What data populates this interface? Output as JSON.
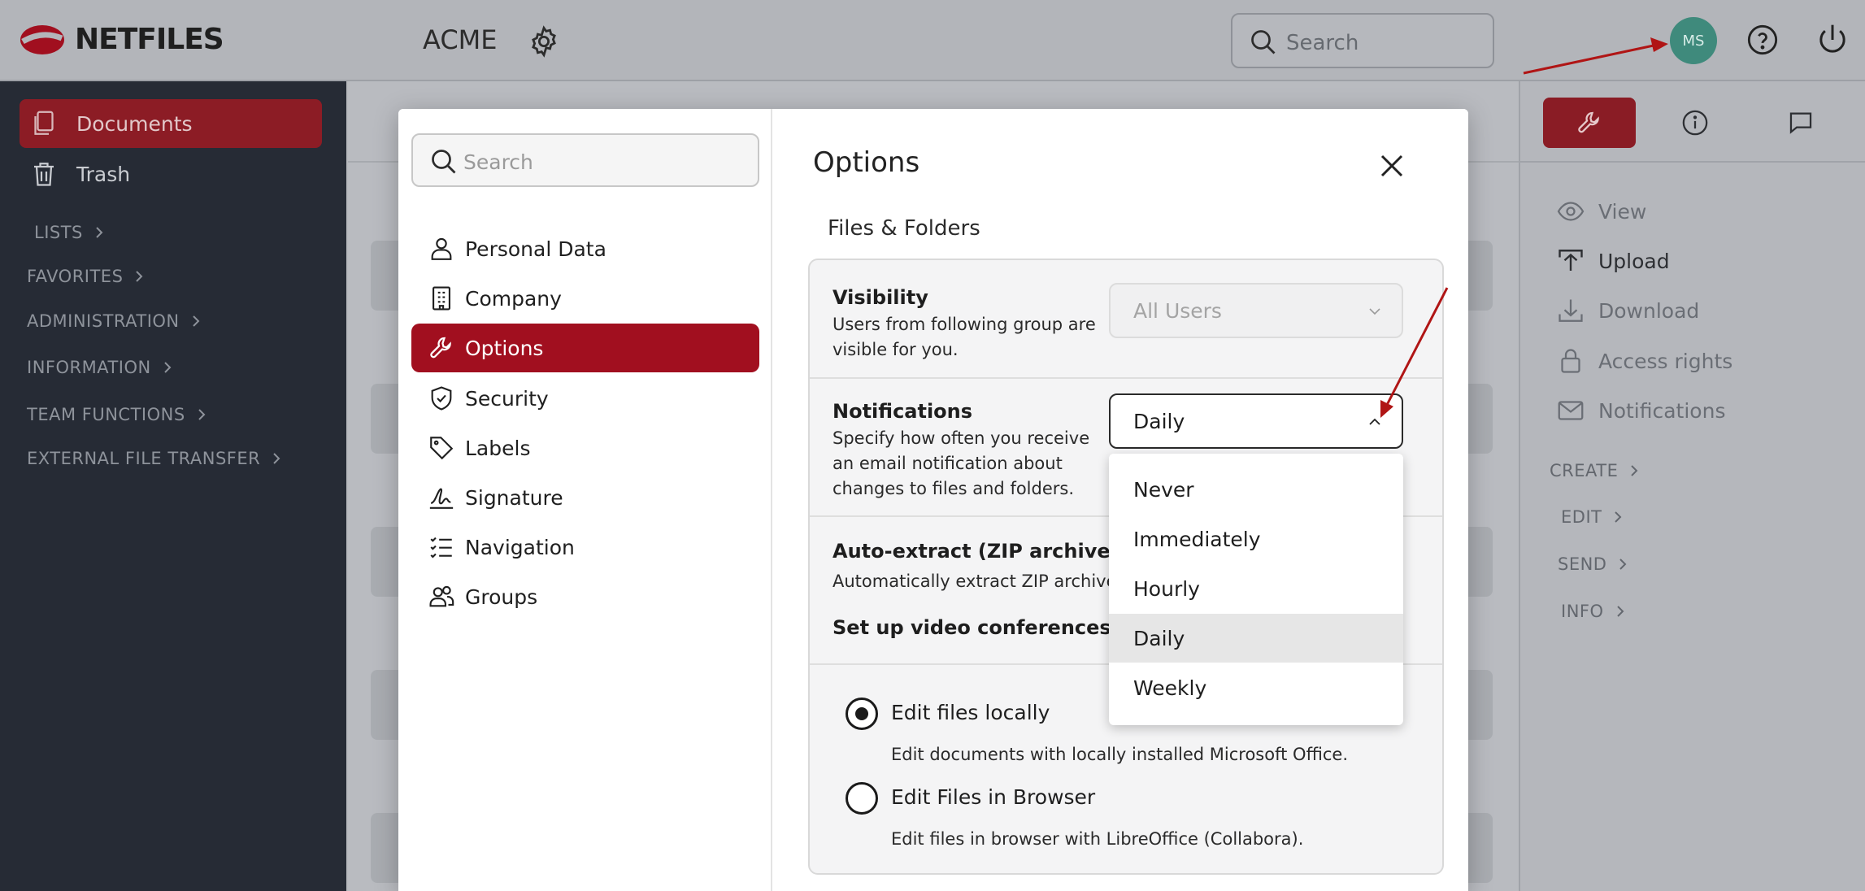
{
  "header": {
    "logo_text": "NETFILES",
    "workspace": "ACME",
    "search_placeholder": "Search",
    "avatar_initials": "MS"
  },
  "sidebar": {
    "items": [
      {
        "label": "Documents",
        "icon": "documents-icon",
        "active": true
      },
      {
        "label": "Trash",
        "icon": "trash-icon",
        "active": false
      }
    ],
    "sections": [
      "LISTS",
      "FAVORITES",
      "ADMINISTRATION",
      "INFORMATION",
      "TEAM FUNCTIONS",
      "EXTERNAL FILE TRANSFER"
    ]
  },
  "right_panel": {
    "tabs": [
      {
        "icon": "wrench-icon",
        "active": true
      },
      {
        "icon": "info-icon",
        "active": false
      },
      {
        "icon": "comment-icon",
        "active": false
      }
    ],
    "actions": [
      {
        "label": "View",
        "icon": "eye-icon"
      },
      {
        "label": "Upload",
        "icon": "upload-icon"
      },
      {
        "label": "Download",
        "icon": "download-icon"
      },
      {
        "label": "Access rights",
        "icon": "lock-icon"
      },
      {
        "label": "Notifications",
        "icon": "mail-icon"
      }
    ],
    "sections": [
      "CREATE",
      "EDIT",
      "SEND",
      "INFO"
    ]
  },
  "modal": {
    "search_placeholder": "Search",
    "nav": [
      {
        "label": "Personal Data",
        "icon": "person-icon"
      },
      {
        "label": "Company",
        "icon": "building-icon"
      },
      {
        "label": "Options",
        "icon": "wrench-icon",
        "active": true
      },
      {
        "label": "Security",
        "icon": "shield-icon"
      },
      {
        "label": "Labels",
        "icon": "tag-icon"
      },
      {
        "label": "Signature",
        "icon": "signature-icon"
      },
      {
        "label": "Navigation",
        "icon": "checklist-icon"
      },
      {
        "label": "Groups",
        "icon": "group-icon"
      }
    ],
    "title": "Options",
    "subtitle": "Files & Folders",
    "visibility": {
      "label": "Visibility",
      "desc": "Users from following group are visible for you.",
      "value": "All Users"
    },
    "notifications": {
      "label": "Notifications",
      "desc": "Specify how often you receive an email notification about changes to files and folders.",
      "value": "Daily",
      "options": [
        "Never",
        "Immediately",
        "Hourly",
        "Daily",
        "Weekly"
      ],
      "selected": "Daily"
    },
    "auto_extract": {
      "label": "Auto-extract (ZIP archives)",
      "desc": "Automatically extract ZIP archives"
    },
    "video": {
      "label": "Set up video conferences"
    },
    "edit_mode": [
      {
        "label": "Edit files locally",
        "desc": "Edit documents with locally installed Microsoft Office.",
        "checked": true
      },
      {
        "label": "Edit Files in Browser",
        "desc": "Edit files in browser with LibreOffice (Collabora).",
        "checked": false
      }
    ]
  },
  "colors": {
    "brand_red": "#a10f1f",
    "sidebar_bg": "#262b35",
    "avatar": "#3f8a7c",
    "annotation_arrow": "#b01515"
  }
}
